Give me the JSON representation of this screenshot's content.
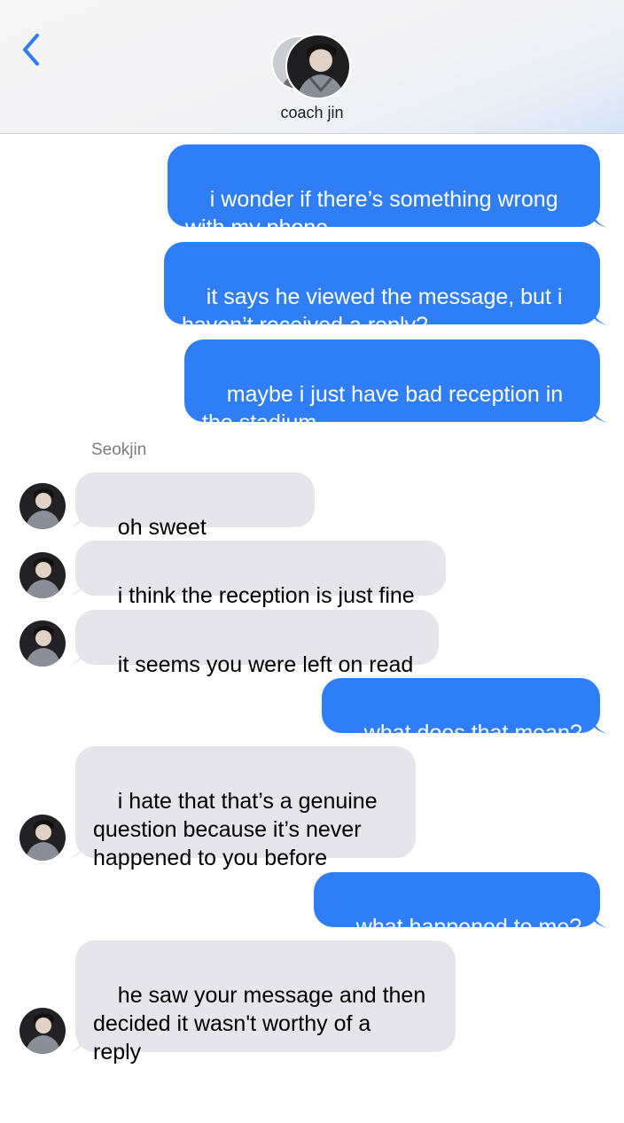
{
  "header": {
    "contact_name": "coach jin"
  },
  "thread": {
    "sender_label": "Seokjin",
    "messages": [
      {
        "from": "me",
        "text": "i wonder if there’s something wrong\nwith my phone"
      },
      {
        "from": "me",
        "text": "it says he viewed the message, but i\nhaven’t received a reply?"
      },
      {
        "from": "me",
        "text": "maybe i just have bad reception in\nthe stadium"
      },
      {
        "from": "them",
        "text": "oh sweet jungkook"
      },
      {
        "from": "them",
        "text": "i think the reception is just fine"
      },
      {
        "from": "them",
        "text": "it seems you were left on read"
      },
      {
        "from": "me",
        "text": "what does that mean?"
      },
      {
        "from": "them",
        "text": "i hate that that’s a genuine\nquestion because it’s never\nhappened to you before"
      },
      {
        "from": "me",
        "text": "what happened to me?"
      },
      {
        "from": "them",
        "text": "he saw your message and then\ndecided it wasn't worthy of a\nreply"
      }
    ]
  },
  "colors": {
    "outgoing_bubble": "#2f7ef6",
    "incoming_bubble": "#e6e5eb",
    "accent": "#2f7ef6"
  },
  "icons": {
    "back": "chevron-left-icon",
    "avatar": "avatar"
  }
}
